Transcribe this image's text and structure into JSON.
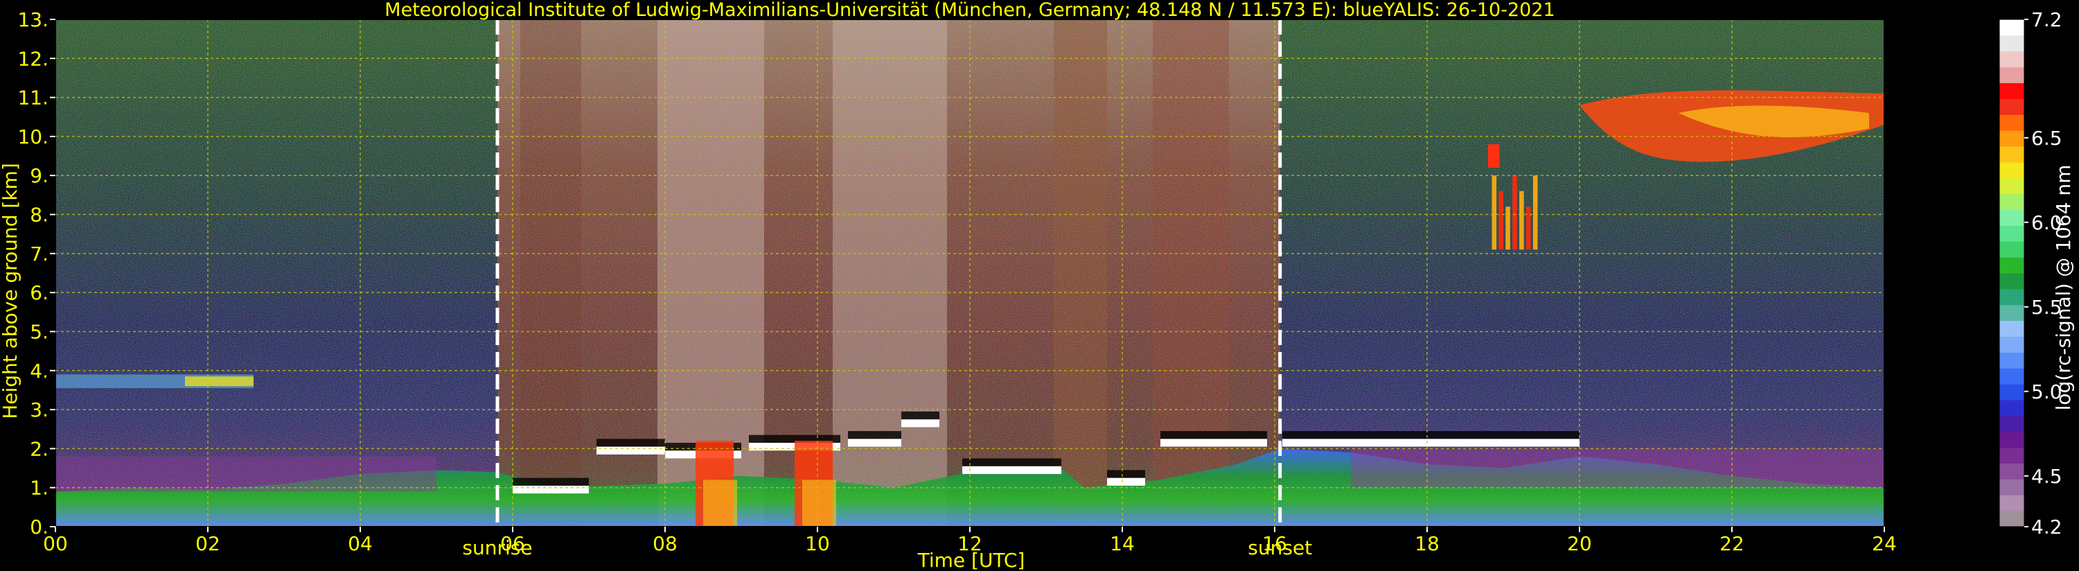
{
  "chart_data": {
    "type": "heatmap",
    "title": "Meteorological Institute of Ludwig-Maximilians-Universität (München, Germany; 48.148 N / 11.573 E):    blueYALIS: 26-10-2021",
    "xlabel": "Time [UTC]",
    "ylabel": "Height above ground [km]",
    "xlim": [
      0,
      24
    ],
    "ylim": [
      0,
      13
    ],
    "x_ticks": [
      "00",
      "02",
      "04",
      "06",
      "08",
      "10",
      "12",
      "14",
      "16",
      "18",
      "20",
      "22",
      "24"
    ],
    "y_ticks": [
      "0.",
      "1.",
      "2.",
      "3.",
      "4.",
      "5.",
      "6.",
      "7.",
      "8.",
      "9.",
      "10.",
      "11.",
      "12.",
      "13."
    ],
    "grid": true,
    "annotations": [
      {
        "label": "sunrise",
        "time": 5.8
      },
      {
        "label": "sunset",
        "time": 16.07
      }
    ],
    "colorbar": {
      "label": "log(rc-signal) @ 1064 nm",
      "range": [
        4.2,
        7.2
      ],
      "ticks": [
        "4.2",
        "4.5",
        "5.0",
        "5.5",
        "6.0",
        "6.5",
        "7.2"
      ],
      "colors": [
        "#a0909a",
        "#b08fb0",
        "#9a6fa6",
        "#8a4f9a",
        "#7a2d92",
        "#6a1a8f",
        "#4a1fa8",
        "#2f2fd0",
        "#2a4ee8",
        "#3c6df6",
        "#5c8ef8",
        "#7fabf9",
        "#99c0f7",
        "#5cb8a6",
        "#2aa67a",
        "#1f9a40",
        "#2ab82a",
        "#3fd16a",
        "#5ce38f",
        "#7ff0a5",
        "#a6f06a",
        "#d7f03a",
        "#f5e81e",
        "#ffc41a",
        "#ff9c12",
        "#ff6a0a",
        "#f0301a",
        "#ff0a0a",
        "#e8a0a0",
        "#f0c8c8",
        "#e8e8e8",
        "#ffffff"
      ]
    },
    "features": [
      {
        "name": "mixed layer top",
        "start": 0,
        "end": 24,
        "approx_height_km": [
          0.3,
          1.0,
          1.5
        ]
      },
      {
        "name": "residual layer",
        "start": 0,
        "end": 2.6,
        "height_km": [
          3.6,
          3.9
        ]
      },
      {
        "name": "low cloud layer",
        "start": 6.0,
        "end": 16.0,
        "height_km": [
          1.0,
          2.6
        ]
      },
      {
        "name": "stratus deck after sunset",
        "start": 16.1,
        "end": 20.0,
        "height_km": [
          2.1,
          2.3
        ]
      },
      {
        "name": "cirrus fallstreaks",
        "start": 18.8,
        "end": 19.5,
        "height_km": [
          7.0,
          9.8
        ]
      },
      {
        "name": "cirrus",
        "start": 20.0,
        "end": 24.0,
        "height_km": [
          9.1,
          11.2
        ]
      }
    ],
    "colors": {
      "text": "#ffff00",
      "grid": "#c8c800",
      "annotation_line": "#ffffff"
    }
  }
}
